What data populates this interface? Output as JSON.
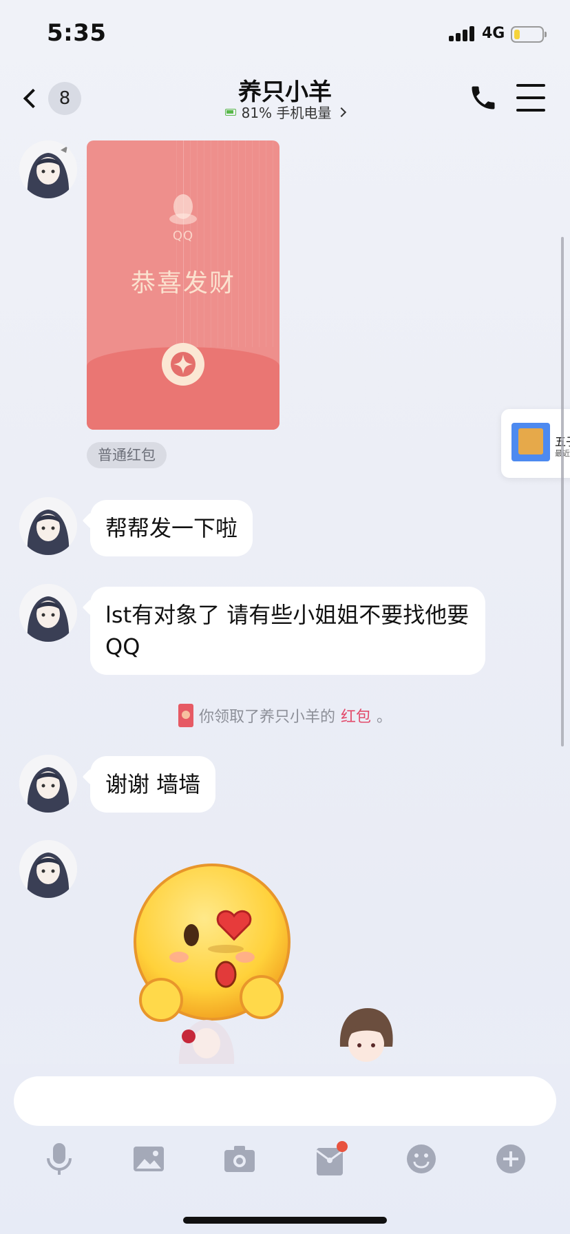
{
  "status_bar": {
    "time": "5:35",
    "network": "4G",
    "battery_level": 0.2,
    "battery_color": "#f5d33a"
  },
  "header": {
    "unread_count": "8",
    "title": "养只小羊",
    "subtitle": "81% 手机电量",
    "icons": [
      "back-chevron-icon",
      "phone-icon",
      "menu-icon"
    ]
  },
  "messages": {
    "red_packet": {
      "logo_text": "QQ",
      "title": "恭喜发财",
      "tag": "普通红包",
      "color": "#ee8f8c"
    },
    "bubble1": "帮帮发一下啦",
    "bubble2": "lst有对象了 请有些小姐姐不要找他要QQ",
    "system": {
      "prefix": "你领取了养只小羊的",
      "link": "红包",
      "suffix": "。"
    },
    "bubble3": "谢谢  墙墙"
  },
  "floating_card": {
    "title": "五子",
    "subtitle": "最近"
  },
  "input": {
    "placeholder": ""
  },
  "toolbar": {
    "icons": [
      "microphone-icon",
      "image-icon",
      "camera-icon",
      "red-packet-icon",
      "emoji-icon",
      "plus-icon"
    ],
    "notification_color": "#e8533f"
  }
}
